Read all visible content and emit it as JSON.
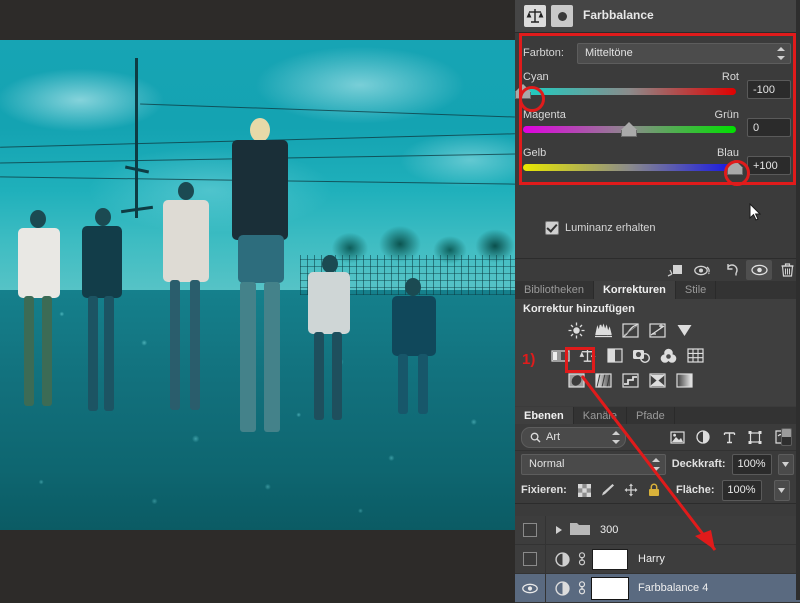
{
  "properties_panel": {
    "title": "Farbbalance",
    "icon": "color-balance-icon",
    "mask_icon": "layer-mask-icon",
    "tone_label": "Farbton:",
    "tone_value": "Mitteltöne",
    "sliders": [
      {
        "left_label": "Cyan",
        "right_label": "Rot",
        "value": "-100",
        "position_pct": 0,
        "from": "#19d0c4",
        "mid": "#8b8b8b",
        "to": "#e00000"
      },
      {
        "left_label": "Magenta",
        "right_label": "Grün",
        "value": "0",
        "position_pct": 50,
        "from": "#e000e0",
        "mid": "#8b8b8b",
        "to": "#00e000"
      },
      {
        "left_label": "Gelb",
        "right_label": "Blau",
        "value": "+100",
        "position_pct": 100,
        "from": "#e8e800",
        "mid": "#8b8b8b",
        "to": "#1414e6"
      }
    ],
    "preserve_luminosity_label": "Luminanz erhalten",
    "preserve_luminosity_checked": "true",
    "annotation_color": "#e01b1b"
  },
  "panel_tools": [
    {
      "name": "clip-to-layer-icon"
    },
    {
      "name": "preview-toggle-icon"
    },
    {
      "name": "reset-icon"
    },
    {
      "name": "visibility-eye-icon"
    },
    {
      "name": "delete-trash-icon"
    }
  ],
  "adjustments_panel": {
    "tabs": [
      {
        "label": "Bibliotheken",
        "active": "false"
      },
      {
        "label": "Korrekturen",
        "active": "true"
      },
      {
        "label": "Stile",
        "active": "false"
      }
    ],
    "heading": "Korrektur hinzufügen",
    "step_marker": "1)",
    "rows": [
      [
        "brightness-contrast-icon",
        "levels-icon",
        "curves-icon",
        "exposure-icon",
        "vibrance-icon"
      ],
      [
        "hue-saturation-icon",
        "color-balance-icon",
        "black-white-icon",
        "photo-filter-icon",
        "channel-mixer-icon",
        "color-lookup-icon"
      ],
      [
        "invert-icon",
        "posterize-icon",
        "threshold-icon",
        "gradient-map-icon",
        "selective-color-icon"
      ]
    ],
    "highlighted_icon": "color-balance-icon"
  },
  "layers_panel": {
    "tabs": [
      {
        "label": "Ebenen",
        "active": "true"
      },
      {
        "label": "Kanäle",
        "active": "false"
      },
      {
        "label": "Pfade",
        "active": "false"
      }
    ],
    "filter_label": "Art",
    "filter_icons": [
      "pixel-filter-icon",
      "adjustment-filter-icon",
      "type-filter-icon",
      "shape-filter-icon",
      "smart-object-filter-icon"
    ],
    "blend_mode": "Normal",
    "opacity_label": "Deckkraft:",
    "opacity_value": "100%",
    "lock_label": "Fixieren:",
    "lock_icons": [
      "lock-transparency-icon",
      "lock-image-icon",
      "lock-position-icon",
      "lock-all-icon"
    ],
    "fill_label": "Fläche:",
    "fill_value": "100%",
    "layers": [
      {
        "name": "300",
        "type": "group",
        "visible": "false",
        "selected": "false"
      },
      {
        "name": "Harry",
        "type": "adjustment",
        "visible": "false",
        "selected": "false"
      },
      {
        "name": "Farbbalance 4",
        "type": "adjustment",
        "visible": "true",
        "selected": "true"
      }
    ]
  },
  "canvas": {
    "document_name": "group-photo-teal-tinted"
  }
}
